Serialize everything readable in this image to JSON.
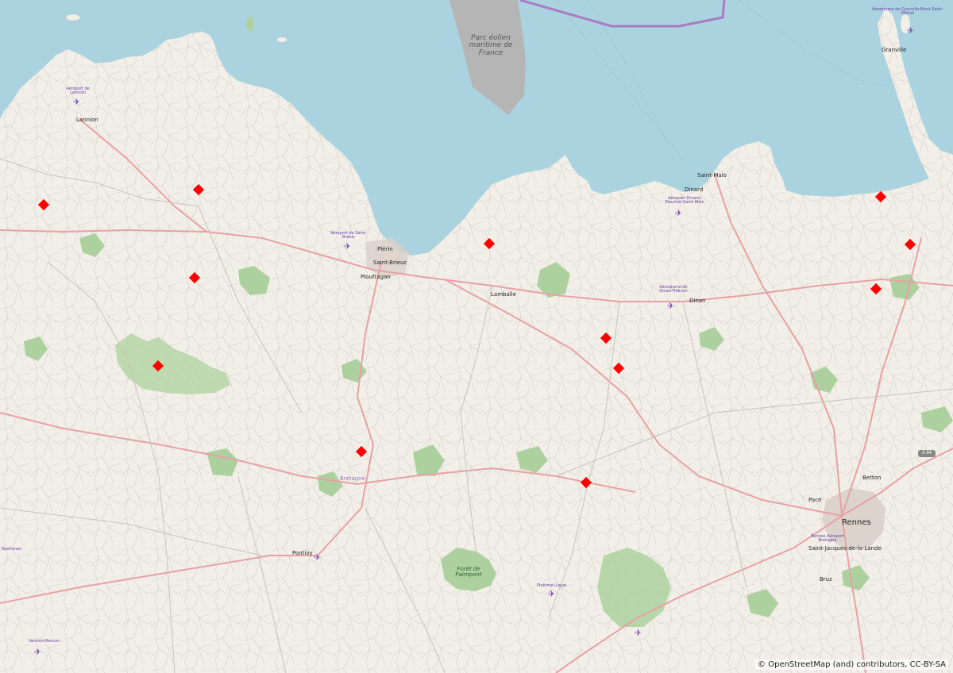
{
  "map": {
    "attribution": "© OpenStreetMap (and) contributors, CC-BY-SA",
    "colors": {
      "sea": "#aad3df",
      "land": "#f2efe9",
      "forest": "#add19e",
      "restricted_area": "#b5b5b5",
      "boundary": "#a87bc2",
      "marker": "#ff0000",
      "road_primary": "#e8a1a4",
      "road_secondary": "#b5b5b5"
    },
    "labels": {
      "sea_area": "Parc éolien maritime de France",
      "saint_malo": "Saint-Malo",
      "dinard": "Dinard",
      "aeroport_dinard": "Aéroport Dinard-Pleurtuit-Saint-Malo",
      "lannion": "Lannion",
      "aeroport_lannion": "Aéroport de Lannion",
      "aeroport_saint_brieuc": "Aéroport de Saint-Brieuc",
      "plerin": "Plérin",
      "saint_brieuc": "Saint-Brieuc",
      "ploufragan": "Ploufragan",
      "lamballe": "Lamballe",
      "aerodrome_dinan": "Aérodrome de Dinan-Trélivan",
      "dinan": "Dinan",
      "granville": "Granville",
      "aerodrome_granville": "Aérodrome de Granville-Mont-Saint-Michel",
      "bretagne": "Bretagne",
      "pontivy": "Pontivy",
      "foret_paimpont": "Forêt de Paimpont",
      "ploermel_loyat": "Ploërmel-Loyat",
      "rennes": "Rennes",
      "aeroport_rennes": "Rennes Aéroport Bretagne",
      "saint_jacques": "Saint-Jacques-de-la-Lande",
      "pace": "Pacé",
      "betton": "Betton",
      "bruz": "Bruz",
      "vannes_meucon": "Vannes-Meucon",
      "a84": "A 84",
      "rosporden": "Rostrenen"
    },
    "markers": [
      "marker-01",
      "marker-02",
      "marker-03",
      "marker-04",
      "marker-05",
      "marker-06",
      "marker-07",
      "marker-08",
      "marker-09",
      "marker-10",
      "marker-11",
      "marker-12",
      "marker-13",
      "marker-14",
      "marker-15"
    ]
  }
}
